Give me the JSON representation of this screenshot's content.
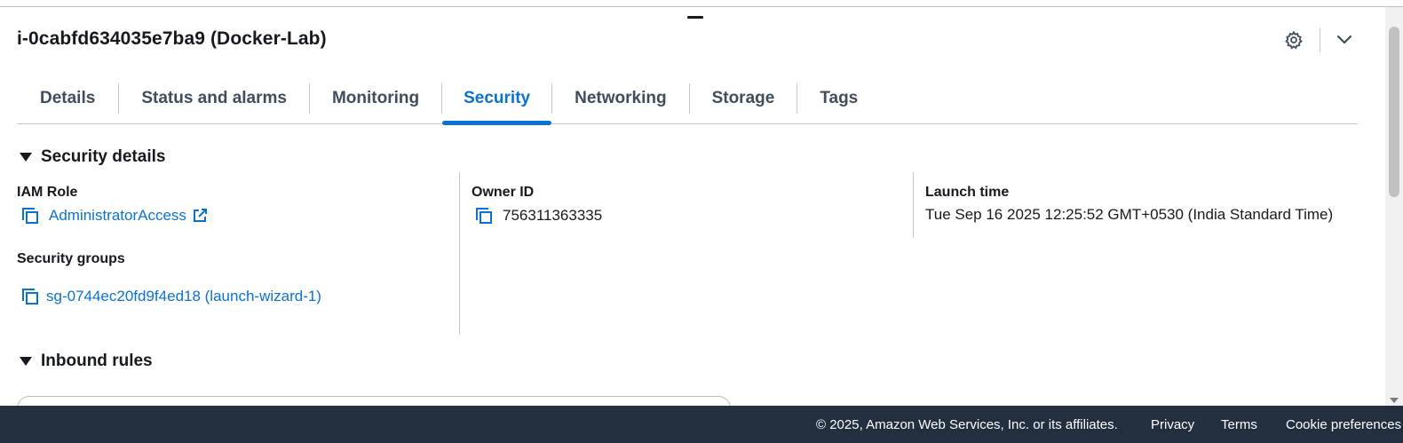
{
  "panel": {
    "title": "i-0cabfd634035e7ba9 (Docker-Lab)"
  },
  "header_actions": {
    "settings_icon": "gear-icon",
    "collapse_icon": "chevron-down-icon"
  },
  "tabs": [
    {
      "label": "Details",
      "active": false
    },
    {
      "label": "Status and alarms",
      "active": false
    },
    {
      "label": "Monitoring",
      "active": false
    },
    {
      "label": "Security",
      "active": true
    },
    {
      "label": "Networking",
      "active": false
    },
    {
      "label": "Storage",
      "active": false
    },
    {
      "label": "Tags",
      "active": false
    }
  ],
  "security_details": {
    "heading": "Security details",
    "iam_role": {
      "label": "IAM Role",
      "value": "AdministratorAccess"
    },
    "security_groups": {
      "label": "Security groups",
      "value": "sg-0744ec20fd9f4ed18 (launch-wizard-1)"
    },
    "owner_id": {
      "label": "Owner ID",
      "value": "756311363335"
    },
    "launch_time": {
      "label": "Launch time",
      "value": "Tue Sep 16 2025 12:25:52 GMT+0530 (India Standard Time)"
    }
  },
  "inbound_rules": {
    "heading": "Inbound rules"
  },
  "footer": {
    "copyright": "© 2025, Amazon Web Services, Inc. or its affiliates.",
    "privacy": "Privacy",
    "terms": "Terms",
    "cookie": "Cookie preferences"
  },
  "colors": {
    "link": "#0972d3",
    "footer_bg": "#232f3e",
    "text": "#16191f"
  }
}
